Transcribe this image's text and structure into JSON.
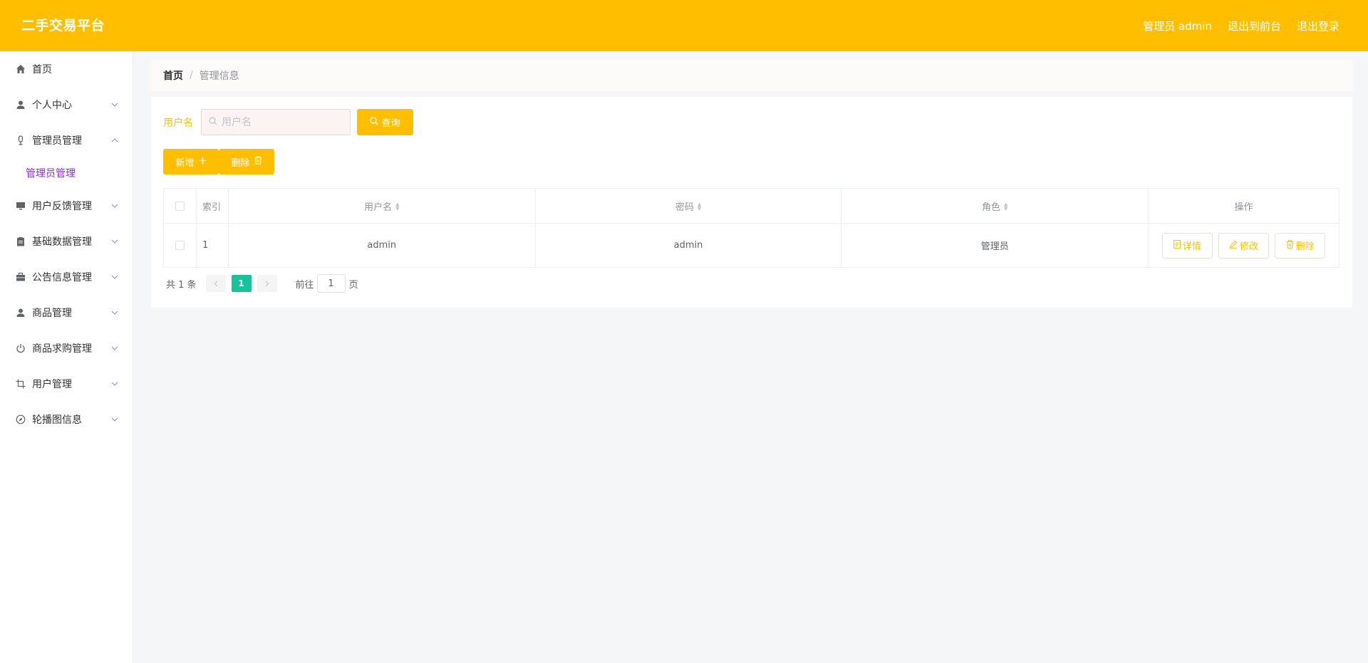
{
  "app": {
    "title": "二手交易平台",
    "colors": {
      "accent": "#ffbf00",
      "submenu_active": "#8a2be2",
      "pager_active": "#18c29c"
    }
  },
  "header": {
    "user_label": "管理员 admin",
    "to_front": "退出到前台",
    "logout": "退出登录"
  },
  "sidebar": {
    "items": [
      {
        "label": "首页",
        "icon": "home-icon",
        "expandable": false
      },
      {
        "label": "个人中心",
        "icon": "user-icon",
        "expandable": true,
        "expanded": false
      },
      {
        "label": "管理员管理",
        "icon": "microphone-icon",
        "expandable": true,
        "expanded": true
      },
      {
        "label": "用户反馈管理",
        "icon": "monitor-icon",
        "expandable": true,
        "expanded": false
      },
      {
        "label": "基础数据管理",
        "icon": "clipboard-icon",
        "expandable": true,
        "expanded": false
      },
      {
        "label": "公告信息管理",
        "icon": "briefcase-icon",
        "expandable": true,
        "expanded": false
      },
      {
        "label": "商品管理",
        "icon": "user-icon",
        "expandable": true,
        "expanded": false
      },
      {
        "label": "商品求购管理",
        "icon": "power-icon",
        "expandable": true,
        "expanded": false
      },
      {
        "label": "用户管理",
        "icon": "crop-icon",
        "expandable": true,
        "expanded": false
      },
      {
        "label": "轮播图信息",
        "icon": "compass-icon",
        "expandable": true,
        "expanded": false
      }
    ],
    "submenu": {
      "label": "管理员管理"
    }
  },
  "breadcrumb": {
    "home": "首页",
    "separator": "/",
    "current": "管理信息"
  },
  "search": {
    "label": "用户名",
    "placeholder": "用户名",
    "value": "",
    "button": "查询"
  },
  "actions": {
    "add": "新增",
    "delete": "删除"
  },
  "table": {
    "headers": {
      "index": "索引",
      "username": "用户名",
      "password": "密码",
      "role": "角色",
      "operation": "操作"
    },
    "rows": [
      {
        "index": "1",
        "username": "admin",
        "password": "admin",
        "role": "管理员"
      }
    ],
    "row_actions": {
      "detail": "详情",
      "edit": "修改",
      "delete": "删除"
    }
  },
  "pagination": {
    "total": "共 1 条",
    "current_page": "1",
    "goto_prefix": "前往",
    "goto_value": "1",
    "goto_suffix": "页"
  }
}
